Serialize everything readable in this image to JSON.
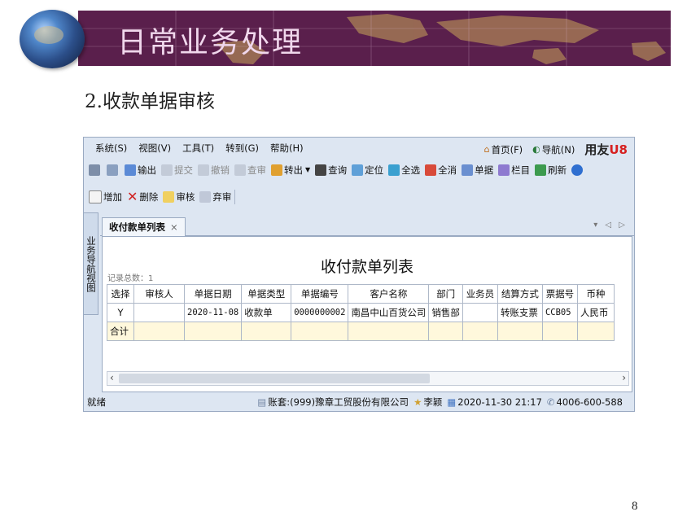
{
  "slide": {
    "banner_title": "日常业务处理",
    "sub_title": "2.收款单据审核",
    "page_number": "8"
  },
  "app": {
    "menu": [
      "系统(S)",
      "视图(V)",
      "工具(T)",
      "转到(G)",
      "帮助(H)"
    ],
    "menu_right": {
      "home": "首页(F)",
      "nav": "导航(N)",
      "brand": "用友",
      "brand_suffix": "U8"
    },
    "toolbar1": [
      {
        "label": "",
        "icon": "print-icon",
        "enabled": true
      },
      {
        "label": "",
        "icon": "preview-icon",
        "enabled": true
      },
      {
        "label": "输出",
        "icon": "export-icon",
        "enabled": true
      },
      {
        "label": "提交",
        "icon": "submit-icon",
        "enabled": false
      },
      {
        "label": "撤销",
        "icon": "undo-icon",
        "enabled": false
      },
      {
        "label": "查审",
        "icon": "check-audit-icon",
        "enabled": false
      },
      {
        "label": "转出",
        "icon": "transfer-out-icon",
        "enabled": true
      },
      {
        "label": "查询",
        "icon": "binoculars-icon",
        "enabled": true
      },
      {
        "label": "定位",
        "icon": "locate-icon",
        "enabled": true
      },
      {
        "label": "全选",
        "icon": "select-all-icon",
        "enabled": true
      },
      {
        "label": "全消",
        "icon": "deselect-all-icon",
        "enabled": true
      },
      {
        "label": "单据",
        "icon": "document-icon",
        "enabled": true
      },
      {
        "label": "栏目",
        "icon": "columns-icon",
        "enabled": true
      },
      {
        "label": "刷新",
        "icon": "refresh-icon",
        "enabled": true
      },
      {
        "label": "",
        "icon": "help-icon",
        "enabled": true
      }
    ],
    "toolbar2": [
      {
        "label": "增加",
        "icon": "add-icon"
      },
      {
        "label": "删除",
        "icon": "delete-icon"
      },
      {
        "label": "审核",
        "icon": "audit-icon"
      },
      {
        "label": "弃审",
        "icon": "abandon-audit-icon"
      }
    ],
    "side_panel_label": "业务导航视图",
    "tab_label": "收付款单列表",
    "list_title": "收付款单列表",
    "record_count": "记录总数：1",
    "columns": [
      "选择",
      "审核人",
      "单据日期",
      "单据类型",
      "单据编号",
      "客户名称",
      "部门",
      "业务员",
      "结算方式",
      "票据号",
      "币种"
    ],
    "rows": [
      [
        "Y",
        "",
        "2020-11-08",
        "收款单",
        "0000000002",
        "南昌中山百货公司",
        "销售部",
        "",
        "转账支票",
        "CCB05",
        "人民币"
      ]
    ],
    "total_label": "合计",
    "status": {
      "left": "就绪",
      "account": "账套:(999)豫章工贸股份有限公司",
      "user": "李颖",
      "datetime": "2020-11-30 21:17",
      "phone": "4006-600-588"
    }
  }
}
